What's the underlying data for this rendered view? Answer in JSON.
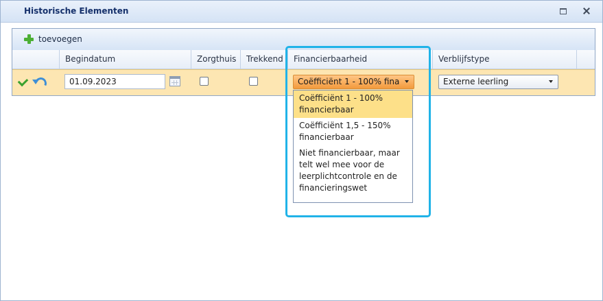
{
  "window": {
    "title": "Historische Elementen",
    "buttons": [
      "maximize-icon",
      "close-icon"
    ]
  },
  "toolbar": {
    "add_label": "toevoegen",
    "add_icon": "plus-icon"
  },
  "columns": [
    "Begindatum",
    "Zorgthuis",
    "Trekkend",
    "Financierbaarheid",
    "Verblijfstype"
  ],
  "row": {
    "actions": [
      "check-icon",
      "undo-icon"
    ],
    "begindatum": "01.09.2023",
    "zorgthuis": false,
    "trekkend": false,
    "financierbaarheid": "Coëfficiënt 1 - 100% financierbaar",
    "verblijfstype": "Externe leerling"
  },
  "dropdown": {
    "options": [
      {
        "label": "Coëfficiënt 1 - 100% financierbaar",
        "selected": true
      },
      {
        "label": "Coëfficiënt 1,5 - 150% financierbaar",
        "selected": false
      },
      {
        "label": "Niet financierbaar, maar telt wel mee voor de leerplichtcontrole en de financieringswet",
        "selected": false
      }
    ]
  },
  "colors": {
    "row_highlight": "#fde6b2",
    "active_select": "#f39a3d",
    "selected_option": "#fde089",
    "annotation_outline": "#20b3e8"
  }
}
